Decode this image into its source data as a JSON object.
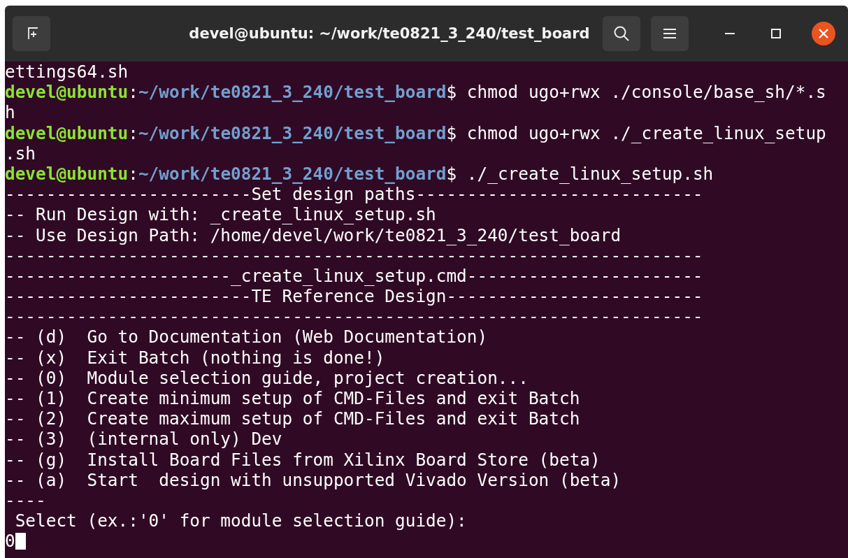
{
  "window": {
    "title": "devel@ubuntu: ~/work/te0821_3_240/test_board"
  },
  "terminal": {
    "lines": [
      {
        "kind": "output",
        "text": "ettings64.sh"
      },
      {
        "kind": "prompt",
        "user": "devel@ubuntu",
        "separator": ":",
        "path": "~/work/te0821_3_240/test_board",
        "symbol": "$",
        "command": " chmod ugo+rwx ./console/base_sh/*.s"
      },
      {
        "kind": "output",
        "text": "h"
      },
      {
        "kind": "prompt",
        "user": "devel@ubuntu",
        "separator": ":",
        "path": "~/work/te0821_3_240/test_board",
        "symbol": "$",
        "command": " chmod ugo+rwx ./_create_linux_setup"
      },
      {
        "kind": "output",
        "text": ".sh"
      },
      {
        "kind": "prompt",
        "user": "devel@ubuntu",
        "separator": ":",
        "path": "~/work/te0821_3_240/test_board",
        "symbol": "$",
        "command": " ./_create_linux_setup.sh"
      },
      {
        "kind": "output",
        "text": "------------------------Set design paths----------------------------"
      },
      {
        "kind": "output",
        "text": "-- Run Design with: _create_linux_setup.sh"
      },
      {
        "kind": "output",
        "text": "-- Use Design Path: /home/devel/work/te0821_3_240/test_board"
      },
      {
        "kind": "output",
        "text": "--------------------------------------------------------------------"
      },
      {
        "kind": "output",
        "text": "----------------------_create_linux_setup.cmd-----------------------"
      },
      {
        "kind": "output",
        "text": "------------------------TE Reference Design-------------------------"
      },
      {
        "kind": "output",
        "text": "--------------------------------------------------------------------"
      },
      {
        "kind": "output",
        "text": "-- (d)  Go to Documentation (Web Documentation)"
      },
      {
        "kind": "output",
        "text": "-- (x)  Exit Batch (nothing is done!)"
      },
      {
        "kind": "output",
        "text": "-- (0)  Module selection guide, project creation..."
      },
      {
        "kind": "output",
        "text": "-- (1)  Create minimum setup of CMD-Files and exit Batch"
      },
      {
        "kind": "output",
        "text": "-- (2)  Create maximum setup of CMD-Files and exit Batch"
      },
      {
        "kind": "output",
        "text": "-- (3)  (internal only) Dev"
      },
      {
        "kind": "output",
        "text": "-- (g)  Install Board Files from Xilinx Board Store (beta)"
      },
      {
        "kind": "output",
        "text": "-- (a)  Start  design with unsupported Vivado Version (beta)"
      },
      {
        "kind": "output",
        "text": "----"
      },
      {
        "kind": "output",
        "text": " Select (ex.:'0' for module selection guide):"
      },
      {
        "kind": "input",
        "text": "0",
        "cursor": true
      }
    ]
  }
}
